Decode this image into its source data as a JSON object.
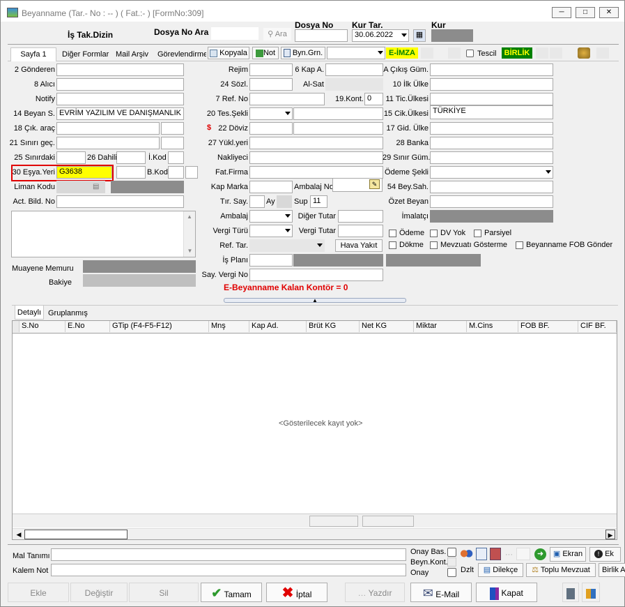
{
  "window": {
    "title": "Beyanname (Tar.- No : -- ) ( Fat.:- ) [FormNo:309]"
  },
  "header": {
    "is_takip": "İş Tak.Dizin",
    "dosya_no_ara": "Dosya No Ara",
    "ara": "Ara",
    "dosya_no_label": "Dosya No",
    "dosya_no_value": "",
    "kur_tar_label": "Kur Tar.",
    "kur_tar_value": "30.06.2022",
    "kur_label": "Kur"
  },
  "tabs": {
    "sayfa1": "Sayfa 1",
    "diger": "Diğer Formlar",
    "mail": "Mail Arşiv",
    "gorev": "Görevlendirme",
    "kopyala": "Kopyala",
    "not": "Not",
    "byn": "Byn.Grn.",
    "eimza": "E-İMZA",
    "tescil": "Tescil",
    "birlik": "BİRLİK"
  },
  "left": {
    "gonderen": "2 Gönderen",
    "alici": "8 Alıcı",
    "notify": "Notify",
    "beyan_s": "14 Beyan S.",
    "beyan_s_value": "EVRİM YAZILIM VE DANIŞMANLIK",
    "cik_arac": "18 Çık. araç",
    "sinir_gec": "21 Sınırı geç.",
    "sinirdaki": "25 Sınırdaki",
    "dahili": "26 Dahili",
    "i_kod": "İ.Kod",
    "esya_yeri": "30 Eşya.Yeri",
    "esya_yeri_value": "G3638",
    "b_kod": "B.Kod",
    "liman_kodu": "Liman Kodu",
    "act_bild": "Act. Bild. No",
    "muayene": "Muayene Memuru",
    "bakiye": "Bakiye"
  },
  "mid": {
    "rejim": "Rejim",
    "kap_a": "6 Kap A.",
    "sozl": "24 Sözl.",
    "al_sat": "Al-Sat",
    "ref_no": "7 Ref. No",
    "kont": "19.Kont.",
    "kont_value": "0",
    "tes_sekli": "20 Tes.Şekli",
    "doviz": "22 Döviz",
    "yukl_yeri": "27 Yükl.yeri",
    "nakliyeci": "Nakliyeci",
    "fat_firma": "Fat.Firma",
    "kap_marka": "Kap Marka",
    "ambalaj_no": "Ambalaj No",
    "tir_say": "Tır. Say.",
    "ay": "Ay",
    "sup": "Sup",
    "sup_value": "11",
    "ambalaj": "Ambalaj",
    "diger_tutar": "Diğer Tutar",
    "vergi_turu": "Vergi Türü",
    "vergi_tutar": "Vergi Tutar",
    "ref_tar": "Ref. Tar.",
    "hava_yakit": "Hava Yakıt",
    "is_plani": "İş Planı",
    "say_vergi": "Say. Vergi No",
    "kontor": "E-Beyanname Kalan Kontör = 0"
  },
  "right": {
    "cikis_gum": "A Çıkış Güm.",
    "ilk_ulke": "10 İlk Ülke",
    "tic_ulkesi": "11 Tic.Ülkesi",
    "cik_ulkesi": "15 Cik.Ülkesi",
    "cik_ulkesi_value": "TÜRKİYE",
    "gid_ulke": "17 Gid. Ülke",
    "banka": "28 Banka",
    "sinir_gum": "29 Sınır Güm.",
    "odeme_sekli": "Ödeme Şekli",
    "bey_sah": "54 Bey.Sah.",
    "ozet_beyan": "Özet Beyan",
    "imalatci": "İmalatçı",
    "odeme": "Ödeme",
    "dv_yok": "DV Yok",
    "parsiyel": "Parsiyel",
    "dokme": "Dökme",
    "mevzuat": "Mevzuatı Gösterme",
    "fob_gonder": "Beyanname FOB Gönder"
  },
  "grid": {
    "tabs": [
      "Detaylı",
      "Gruplanmış"
    ],
    "columns": [
      "S.No",
      "E.No",
      "GTip (F4-F5-F12)",
      "Mnş",
      "Kap Ad.",
      "Brüt KG",
      "Net KG",
      "Miktar",
      "M.Cins",
      "FOB BF.",
      "CIF BF."
    ],
    "empty": "<Gösterilecek kayıt yok>"
  },
  "bottom": {
    "mal_tanimi": "Mal Tanımı",
    "kalem_not": "Kalem Not",
    "onay_bas": "Onay Bas.",
    "beyn_kont": "Beyn.Kont.",
    "onay": "Onay",
    "ekran": "Ekran",
    "ek": "Ek",
    "dzlt": "Dzlt",
    "dilekce": "Dilekçe",
    "toplu_mevzuat": "Toplu Mevzuat",
    "birlik": "Birlik A"
  },
  "actions": {
    "ekle": "Ekle",
    "degistir": "Değiştir",
    "sil": "Sil",
    "tamam": "Tamam",
    "iptal": "İptal",
    "yazdir": "Yazdır",
    "email": "E-Mail",
    "kapat": "Kapat"
  },
  "colors": {
    "highlight": "#ffff00",
    "red_border": "#e00000",
    "eimza_bg": "#ffff00",
    "eimza_fg": "#008000",
    "birlik_bg": "#008000",
    "birlik_fg": "#ffff00",
    "kontor": "#e00000"
  }
}
